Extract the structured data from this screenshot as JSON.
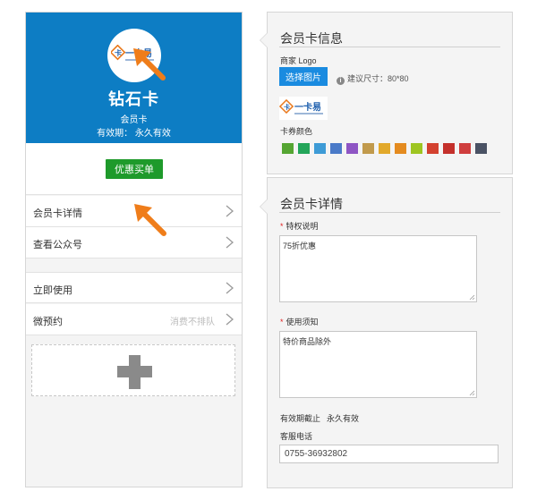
{
  "preview": {
    "card_name": "钻石卡",
    "card_type": "会员卡",
    "validity_label": "有效期：",
    "validity_value": "永久有效",
    "logo_text": "一卡易",
    "discount_button": "优惠买单",
    "menu": [
      {
        "label": "会员卡详情",
        "hint": ""
      },
      {
        "label": "查看公众号",
        "hint": ""
      },
      {
        "label": "立即使用",
        "hint": ""
      },
      {
        "label": "微预约",
        "hint": "消费不排队"
      }
    ]
  },
  "card_info": {
    "title": "会员卡信息",
    "logo_label": "商家 Logo",
    "choose_image_button": "选择图片",
    "size_hint": "建议尺寸：80*80",
    "color_label": "卡券颜色",
    "colors": [
      "#55a532",
      "#23a559",
      "#3e9bd6",
      "#4a7ac8",
      "#8e55c4",
      "#c19a4c",
      "#e2a92b",
      "#e48b1f",
      "#9ec521",
      "#d3412f",
      "#c4302b",
      "#cf3e3e",
      "#4a5264"
    ]
  },
  "card_detail": {
    "title": "会员卡详情",
    "privilege_label": "特权说明",
    "privilege_value": "75折优惠",
    "usage_label": "使用须知",
    "usage_value": "特价商品除外",
    "validity_label": "有效期截止",
    "validity_value": "永久有效",
    "phone_label": "客服电话",
    "phone_value": "0755-36932802"
  },
  "colors": {
    "header_blue": "#0d7dc4",
    "discount_green": "#1e9a2b",
    "button_blue": "#1a8be0",
    "arrow_orange": "#ef7d1a"
  }
}
